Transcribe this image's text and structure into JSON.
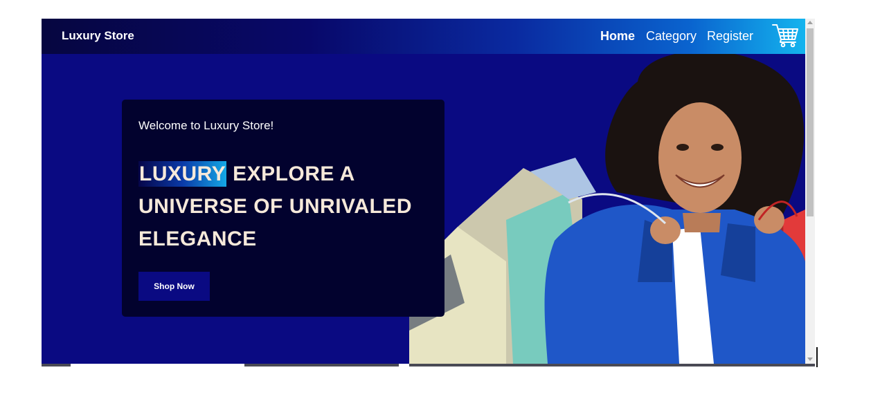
{
  "navbar": {
    "brand": "Luxury Store",
    "links": [
      {
        "label": "Home",
        "active": true
      },
      {
        "label": "Category",
        "active": false
      },
      {
        "label": "Register",
        "active": false
      }
    ],
    "cart_icon": "shopping-cart-icon"
  },
  "hero": {
    "welcome": "Welcome to Luxury Store!",
    "highlight_word": "LUXURY",
    "headline_rest": "EXPLORE A UNIVERSE OF UNRIVALED ELEGANCE",
    "cta_label": "Shop Now",
    "image": "woman holding shopping bags"
  },
  "colors": {
    "page_bg": "#0a0a82",
    "card_bg": "#02022e",
    "headline_text": "#f6e9da",
    "navbar_gradient_end": "#14b4ee"
  }
}
